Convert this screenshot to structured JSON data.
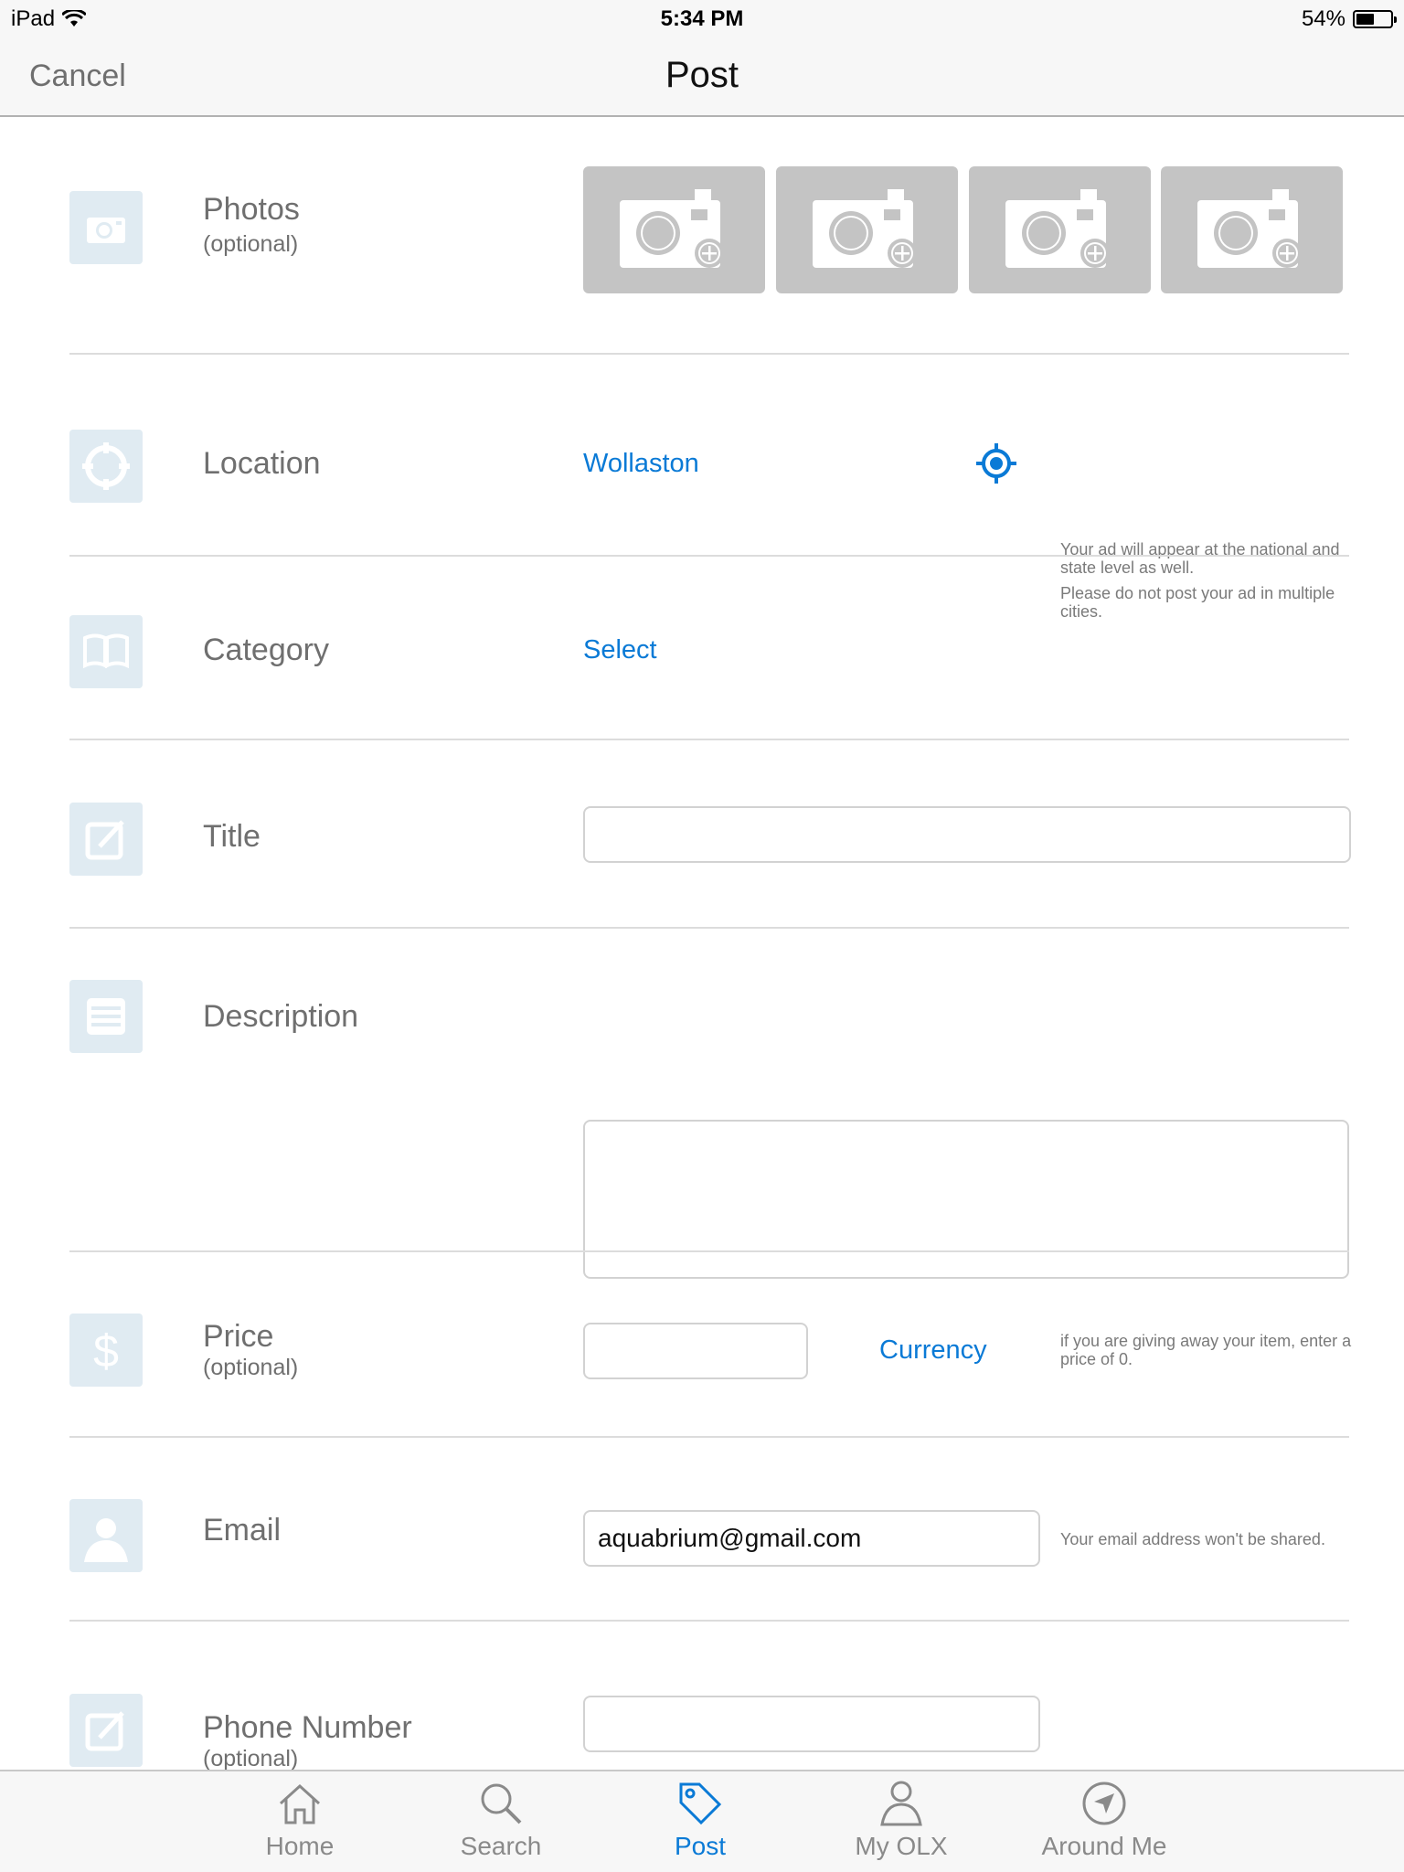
{
  "status": {
    "carrier": "iPad",
    "time": "5:34 PM",
    "battery": "54%",
    "battery_level": 0.54
  },
  "nav": {
    "cancel": "Cancel",
    "title": "Post"
  },
  "photos": {
    "label": "Photos",
    "sub": "(optional)",
    "slots": 4
  },
  "location": {
    "label": "Location",
    "value": "Wollaston",
    "hint1": "Your ad will appear at the national and state level as well.",
    "hint2": "Please do not post your ad in multiple cities."
  },
  "category": {
    "label": "Category",
    "value": "Select"
  },
  "title_field": {
    "label": "Title",
    "value": ""
  },
  "description": {
    "label": "Description",
    "value": ""
  },
  "price": {
    "label": "Price",
    "sub": "(optional)",
    "value": "",
    "currency": "Currency",
    "hint": "if you are giving away your item, enter a price of 0."
  },
  "email": {
    "label": "Email",
    "value": "aquabrium@gmail.com",
    "hint": "Your email address won't be shared."
  },
  "phone": {
    "label": "Phone Number",
    "sub": "(optional)",
    "value": ""
  },
  "tabs": [
    {
      "label": "Home",
      "icon": "home-icon"
    },
    {
      "label": "Search",
      "icon": "search-icon"
    },
    {
      "label": "Post",
      "icon": "tag-icon",
      "active": true
    },
    {
      "label": "My OLX",
      "icon": "person-icon"
    },
    {
      "label": "Around Me",
      "icon": "compass-icon"
    }
  ],
  "colors": {
    "accent": "#0a7ad6",
    "icon_bg": "#e0ebf2",
    "photo_slot": "#c4c4c4"
  }
}
